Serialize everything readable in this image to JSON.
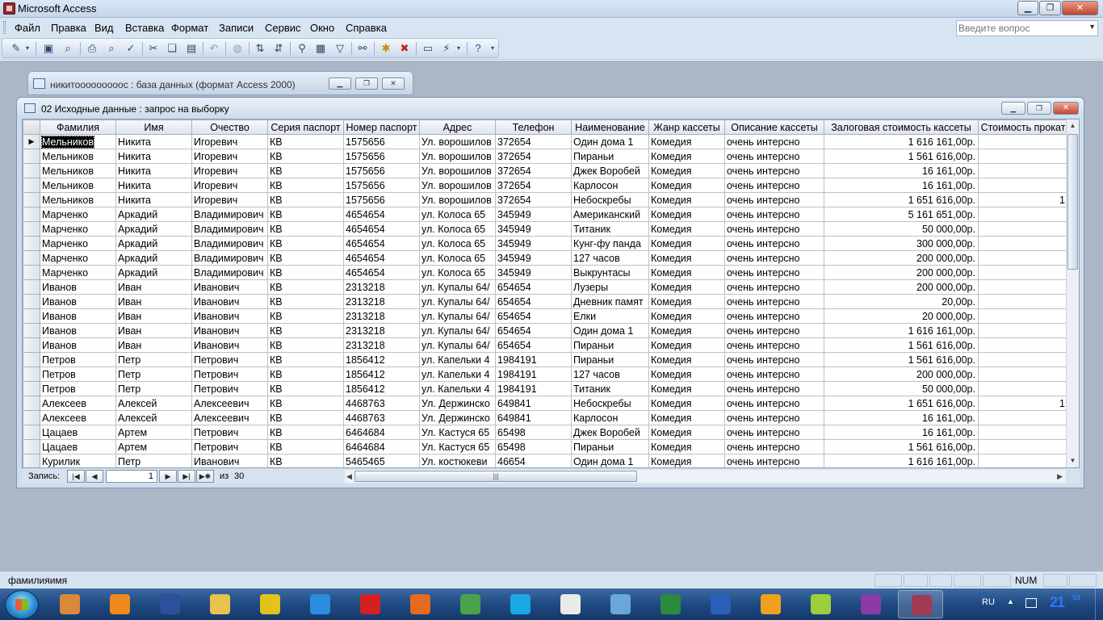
{
  "app": {
    "title": "Microsoft Access"
  },
  "menu": {
    "items": [
      "Файл",
      "Правка",
      "Вид",
      "Вставка",
      "Формат",
      "Записи",
      "Сервис",
      "Окно",
      "Справка"
    ],
    "help_placeholder": "Введите вопрос"
  },
  "toolbar": {
    "icons": [
      "view-icon",
      "save-icon",
      "search-file-icon",
      "print-icon",
      "print-preview-icon",
      "spelling-icon",
      "cut-icon",
      "copy-icon",
      "paste-icon",
      "undo-icon",
      "insert-hyperlink-icon",
      "sort-ascending-icon",
      "sort-descending-icon",
      "filter-by-selection-icon",
      "filter-by-form-icon",
      "apply-filter-icon",
      "find-icon",
      "new-record-icon",
      "delete-record-icon",
      "database-window-icon",
      "new-object-icon",
      "help-icon"
    ]
  },
  "db_window": {
    "title": "никитооооооооос : база данных (формат Access 2000)"
  },
  "query_window": {
    "title": "02 Исходные данные : запрос на выборку",
    "columns": [
      "Фамилия",
      "Имя",
      "Очество",
      "Серия паспорт",
      "Номер паспорт",
      "Адрес",
      "Телефон",
      "Наименование",
      "Жанр кассеты",
      "Описание кассеты",
      "Залоговая стоимость кассеты",
      "Стоимость прокат"
    ],
    "rows": [
      [
        "Мельников",
        "Никита",
        "Игоревич",
        "КВ",
        "1575656",
        "Ул. ворошилов",
        "372654",
        "Один дома 1",
        "Комедия",
        "очень интерсно",
        "1 616 161,00р.",
        ""
      ],
      [
        "Мельников",
        "Никита",
        "Игоревич",
        "КВ",
        "1575656",
        "Ул. ворошилов",
        "372654",
        "Пираньи",
        "Комедия",
        "очень интерсно",
        "1 561 616,00р.",
        ""
      ],
      [
        "Мельников",
        "Никита",
        "Игоревич",
        "КВ",
        "1575656",
        "Ул. ворошилов",
        "372654",
        "Джек Воробей",
        "Комедия",
        "очень интерсно",
        "16 161,00р.",
        ""
      ],
      [
        "Мельников",
        "Никита",
        "Игоревич",
        "КВ",
        "1575656",
        "Ул. ворошилов",
        "372654",
        "Карлосон",
        "Комедия",
        "очень интерсно",
        "16 161,00р.",
        ""
      ],
      [
        "Мельников",
        "Никита",
        "Игоревич",
        "КВ",
        "1575656",
        "Ул. ворошилов",
        "372654",
        "Небоскребы",
        "Комедия",
        "очень интерсно",
        "1 651 616,00р.",
        "1"
      ],
      [
        "Марченко",
        "Аркадий",
        "Владимирович",
        "КВ",
        "4654654",
        "ул. Колоса 65",
        "345949",
        "Американский",
        "Комедия",
        "очень интерсно",
        "5 161 651,00р.",
        ""
      ],
      [
        "Марченко",
        "Аркадий",
        "Владимирович",
        "КВ",
        "4654654",
        "ул. Колоса 65",
        "345949",
        "Титаник",
        "Комедия",
        "очень интерсно",
        "50 000,00р.",
        ""
      ],
      [
        "Марченко",
        "Аркадий",
        "Владимирович",
        "КВ",
        "4654654",
        "ул. Колоса 65",
        "345949",
        "Кунг-фу панда",
        "Комедия",
        "очень интерсно",
        "300 000,00р.",
        ""
      ],
      [
        "Марченко",
        "Аркадий",
        "Владимирович",
        "КВ",
        "4654654",
        "ул. Колоса 65",
        "345949",
        "127 часов",
        "Комедия",
        "очень интерсно",
        "200 000,00р.",
        ""
      ],
      [
        "Марченко",
        "Аркадий",
        "Владимирович",
        "КВ",
        "4654654",
        "ул. Колоса 65",
        "345949",
        "Выкрунтасы",
        "Комедия",
        "очень интерсно",
        "200 000,00р.",
        ""
      ],
      [
        "Иванов",
        "Иван",
        "Иванович",
        "КВ",
        "2313218",
        "ул. Купалы 64/",
        "654654",
        "Лузеры",
        "Комедия",
        "очень интерсно",
        "200 000,00р.",
        ""
      ],
      [
        "Иванов",
        "Иван",
        "Иванович",
        "КВ",
        "2313218",
        "ул. Купалы 64/",
        "654654",
        "Дневник памят",
        "Комедия",
        "очень интерсно",
        "20,00р.",
        ""
      ],
      [
        "Иванов",
        "Иван",
        "Иванович",
        "КВ",
        "2313218",
        "ул. Купалы 64/",
        "654654",
        "Елки",
        "Комедия",
        "очень интерсно",
        "20 000,00р.",
        ""
      ],
      [
        "Иванов",
        "Иван",
        "Иванович",
        "КВ",
        "2313218",
        "ул. Купалы 64/",
        "654654",
        "Один дома 1",
        "Комедия",
        "очень интерсно",
        "1 616 161,00р.",
        ""
      ],
      [
        "Иванов",
        "Иван",
        "Иванович",
        "КВ",
        "2313218",
        "ул. Купалы 64/",
        "654654",
        "Пираньи",
        "Комедия",
        "очень интерсно",
        "1 561 616,00р.",
        ""
      ],
      [
        "Петров",
        "Петр",
        "Петрович",
        "КВ",
        "1856412",
        "ул. Капельки 4",
        "1984191",
        "Пираньи",
        "Комедия",
        "очень интерсно",
        "1 561 616,00р.",
        ""
      ],
      [
        "Петров",
        "Петр",
        "Петрович",
        "КВ",
        "1856412",
        "ул. Капельки 4",
        "1984191",
        "127 часов",
        "Комедия",
        "очень интерсно",
        "200 000,00р.",
        ""
      ],
      [
        "Петров",
        "Петр",
        "Петрович",
        "КВ",
        "1856412",
        "ул. Капельки 4",
        "1984191",
        "Титаник",
        "Комедия",
        "очень интерсно",
        "50 000,00р.",
        ""
      ],
      [
        "Алексеев",
        "Алексей",
        "Алексеевич",
        "КВ",
        "4468763",
        "Ул. Держинско",
        "649841",
        "Небоскребы",
        "Комедия",
        "очень интерсно",
        "1 651 616,00р.",
        "1"
      ],
      [
        "Алексеев",
        "Алексей",
        "Алексеевич",
        "КВ",
        "4468763",
        "Ул. Держинско",
        "649841",
        "Карлосон",
        "Комедия",
        "очень интерсно",
        "16 161,00р.",
        ""
      ],
      [
        "Цацаев",
        "Артем",
        "Петрович",
        "КВ",
        "6464684",
        "Ул.  Кастуся 65",
        "65498",
        "Джек Воробей",
        "Комедия",
        "очень интерсно",
        "16 161,00р.",
        ""
      ],
      [
        "Цацаев",
        "Артем",
        "Петрович",
        "КВ",
        "6464684",
        "Ул.  Кастуся 65",
        "65498",
        "Пираньи",
        "Комедия",
        "очень интерсно",
        "1 561 616,00р.",
        ""
      ],
      [
        "Курилик",
        "Петр",
        "Иванович",
        "КВ",
        "5465465",
        "Ул.  костюкеви",
        "46654",
        "Один дома 1",
        "Комедия",
        "очень интерсно",
        "1 616 161,00р.",
        ""
      ]
    ],
    "nav": {
      "label": "Запись:",
      "current": "1",
      "of": "из",
      "total": "30"
    }
  },
  "status": {
    "text": "фамилияимя",
    "num": "NUM"
  },
  "taskbar": {
    "apps": [
      "winrar-icon",
      "avast-icon",
      "floppy-save-icon",
      "explorer-icon",
      "totalcommander-icon",
      "ie-icon",
      "opera-icon",
      "firefox-icon",
      "chrome-icon",
      "skype-icon",
      "solitaire-icon",
      "calendar-icon",
      "excel-icon",
      "word-icon",
      "info-icon",
      "tool-icon",
      "onenote-icon",
      "access-icon"
    ],
    "lang": "RU",
    "clock": "21",
    "clock_min": "53"
  },
  "colors": {
    "workspace": "#abb6c6",
    "chrome": "#d7e4f2",
    "taskbar": "#1f4a82",
    "selected_cell": "#000000"
  }
}
